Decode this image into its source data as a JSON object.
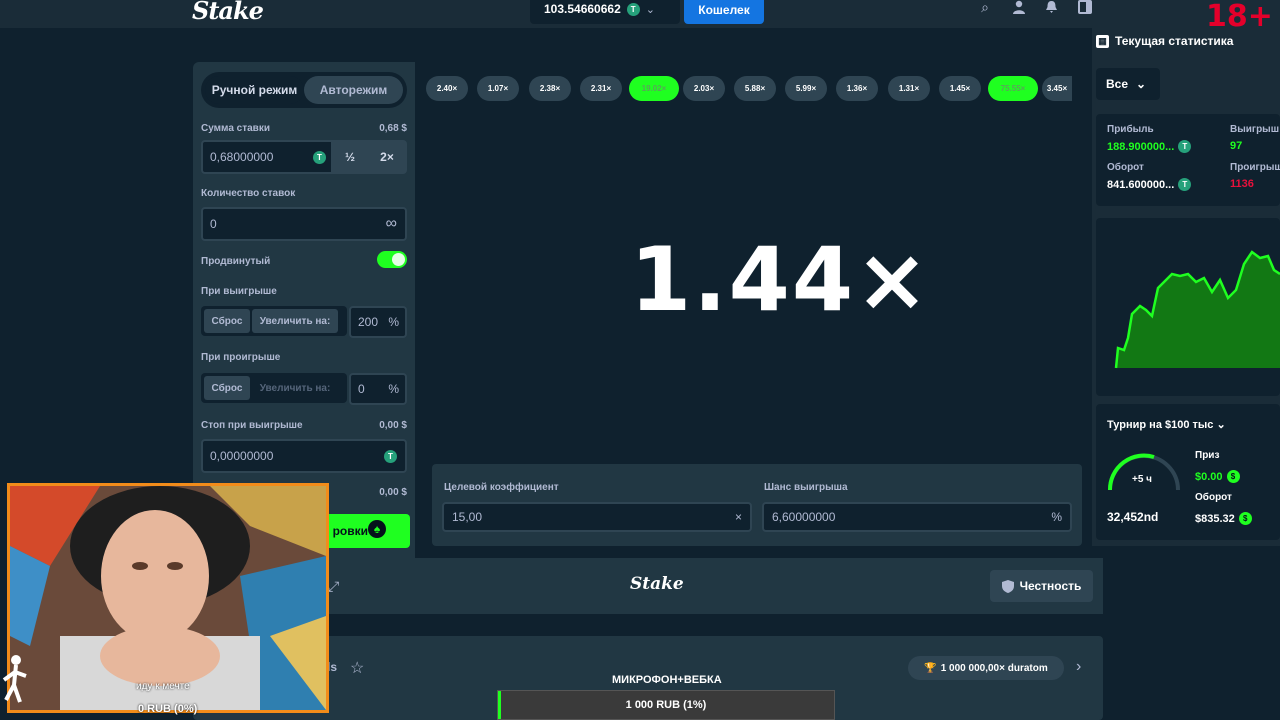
{
  "header": {
    "logo": "Stake",
    "balance": "103.54660662",
    "wallet_label": "Кошелек",
    "age_badge": "18+"
  },
  "controls": {
    "mode_manual": "Ручной режим",
    "mode_auto": "Авторежим",
    "bet_amount_label": "Сумма ставки",
    "bet_amount_usd": "0,68 $",
    "bet_amount_value": "0,68000000",
    "half_label": "½",
    "double_label": "2×",
    "num_bets_label": "Количество ставок",
    "num_bets_value": "0",
    "infinity": "∞",
    "advanced_label": "Продвинутый",
    "on_win_label": "При выигрыше",
    "on_win_reset": "Сброс",
    "on_win_increase": "Увеличить на:",
    "on_win_value": "200",
    "on_loss_label": "При проигрыше",
    "on_loss_reset": "Сброс",
    "on_loss_increase": "Увеличить на:",
    "on_loss_value": "0",
    "percent": "%",
    "stop_win_label": "Стоп при выигрыше",
    "stop_win_usd": "0,00 $",
    "stop_win_value": "0,00000000",
    "stop_loss_usd": "0,00 $",
    "bet_button": "ровки"
  },
  "history": [
    {
      "v": "2.40×",
      "win": false
    },
    {
      "v": "1.07×",
      "win": false
    },
    {
      "v": "2.38×",
      "win": false
    },
    {
      "v": "2.31×",
      "win": false
    },
    {
      "v": "19.02×",
      "win": true
    },
    {
      "v": "2.03×",
      "win": false
    },
    {
      "v": "5.88×",
      "win": false
    },
    {
      "v": "5.99×",
      "win": false
    },
    {
      "v": "1.36×",
      "win": false
    },
    {
      "v": "1.31×",
      "win": false
    },
    {
      "v": "1.45×",
      "win": false
    },
    {
      "v": "75.55×",
      "win": true
    },
    {
      "v": "3.45×",
      "win": false
    }
  ],
  "game": {
    "multiplier": "1.44×",
    "target_label": "Целевой коэффициент",
    "target_value": "15,00",
    "target_suffix": "×",
    "chance_label": "Шанс выигрыша",
    "chance_value": "6,60000000",
    "chance_suffix": "%"
  },
  "footer": {
    "logo": "Stake",
    "fairness": "Честность",
    "bottom_text": "ls",
    "pill": "1 000 000,00× duratom"
  },
  "stats": {
    "title": "Текущая статистика",
    "filter": "Все",
    "profit_label": "Прибыль",
    "profit_value": "188.900000...",
    "wins_label": "Выигрыш",
    "wins_value": "97",
    "turnover_label": "Оборот",
    "turnover_value": "841.600000...",
    "losses_label": "Проигрыш",
    "losses_value": "1136",
    "colors": {
      "profit": "#1fff20",
      "losses": "#e9113c"
    }
  },
  "tournament": {
    "title": "Турнир на $100 тыс",
    "timer": "+5 ч",
    "rank": "32,452nd",
    "prize_label": "Приз",
    "prize_value": "$0.00",
    "turnover_label": "Оборот",
    "turnover_value": "$835.32"
  },
  "stream": {
    "caption1": "иду к мечте",
    "caption2": "0 RUB (0%)",
    "caption3": "МИКРОФОН+ВЕБКА",
    "progress_text": "1 000 RUB (1%)",
    "progress_fraction": 0.01
  }
}
